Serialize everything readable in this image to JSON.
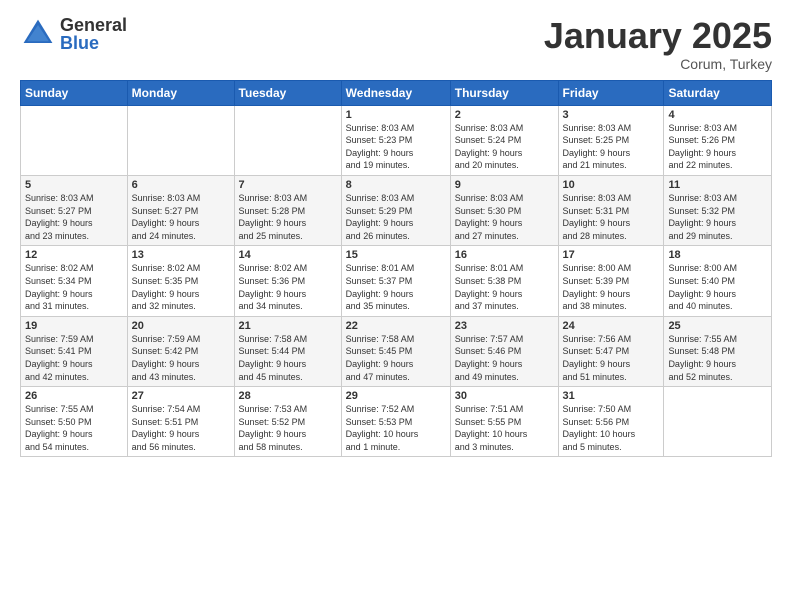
{
  "header": {
    "logo_general": "General",
    "logo_blue": "Blue",
    "title": "January 2025",
    "location": "Corum, Turkey"
  },
  "weekdays": [
    "Sunday",
    "Monday",
    "Tuesday",
    "Wednesday",
    "Thursday",
    "Friday",
    "Saturday"
  ],
  "weeks": [
    [
      {
        "day": "",
        "info": ""
      },
      {
        "day": "",
        "info": ""
      },
      {
        "day": "",
        "info": ""
      },
      {
        "day": "1",
        "info": "Sunrise: 8:03 AM\nSunset: 5:23 PM\nDaylight: 9 hours\nand 19 minutes."
      },
      {
        "day": "2",
        "info": "Sunrise: 8:03 AM\nSunset: 5:24 PM\nDaylight: 9 hours\nand 20 minutes."
      },
      {
        "day": "3",
        "info": "Sunrise: 8:03 AM\nSunset: 5:25 PM\nDaylight: 9 hours\nand 21 minutes."
      },
      {
        "day": "4",
        "info": "Sunrise: 8:03 AM\nSunset: 5:26 PM\nDaylight: 9 hours\nand 22 minutes."
      }
    ],
    [
      {
        "day": "5",
        "info": "Sunrise: 8:03 AM\nSunset: 5:27 PM\nDaylight: 9 hours\nand 23 minutes."
      },
      {
        "day": "6",
        "info": "Sunrise: 8:03 AM\nSunset: 5:27 PM\nDaylight: 9 hours\nand 24 minutes."
      },
      {
        "day": "7",
        "info": "Sunrise: 8:03 AM\nSunset: 5:28 PM\nDaylight: 9 hours\nand 25 minutes."
      },
      {
        "day": "8",
        "info": "Sunrise: 8:03 AM\nSunset: 5:29 PM\nDaylight: 9 hours\nand 26 minutes."
      },
      {
        "day": "9",
        "info": "Sunrise: 8:03 AM\nSunset: 5:30 PM\nDaylight: 9 hours\nand 27 minutes."
      },
      {
        "day": "10",
        "info": "Sunrise: 8:03 AM\nSunset: 5:31 PM\nDaylight: 9 hours\nand 28 minutes."
      },
      {
        "day": "11",
        "info": "Sunrise: 8:03 AM\nSunset: 5:32 PM\nDaylight: 9 hours\nand 29 minutes."
      }
    ],
    [
      {
        "day": "12",
        "info": "Sunrise: 8:02 AM\nSunset: 5:34 PM\nDaylight: 9 hours\nand 31 minutes."
      },
      {
        "day": "13",
        "info": "Sunrise: 8:02 AM\nSunset: 5:35 PM\nDaylight: 9 hours\nand 32 minutes."
      },
      {
        "day": "14",
        "info": "Sunrise: 8:02 AM\nSunset: 5:36 PM\nDaylight: 9 hours\nand 34 minutes."
      },
      {
        "day": "15",
        "info": "Sunrise: 8:01 AM\nSunset: 5:37 PM\nDaylight: 9 hours\nand 35 minutes."
      },
      {
        "day": "16",
        "info": "Sunrise: 8:01 AM\nSunset: 5:38 PM\nDaylight: 9 hours\nand 37 minutes."
      },
      {
        "day": "17",
        "info": "Sunrise: 8:00 AM\nSunset: 5:39 PM\nDaylight: 9 hours\nand 38 minutes."
      },
      {
        "day": "18",
        "info": "Sunrise: 8:00 AM\nSunset: 5:40 PM\nDaylight: 9 hours\nand 40 minutes."
      }
    ],
    [
      {
        "day": "19",
        "info": "Sunrise: 7:59 AM\nSunset: 5:41 PM\nDaylight: 9 hours\nand 42 minutes."
      },
      {
        "day": "20",
        "info": "Sunrise: 7:59 AM\nSunset: 5:42 PM\nDaylight: 9 hours\nand 43 minutes."
      },
      {
        "day": "21",
        "info": "Sunrise: 7:58 AM\nSunset: 5:44 PM\nDaylight: 9 hours\nand 45 minutes."
      },
      {
        "day": "22",
        "info": "Sunrise: 7:58 AM\nSunset: 5:45 PM\nDaylight: 9 hours\nand 47 minutes."
      },
      {
        "day": "23",
        "info": "Sunrise: 7:57 AM\nSunset: 5:46 PM\nDaylight: 9 hours\nand 49 minutes."
      },
      {
        "day": "24",
        "info": "Sunrise: 7:56 AM\nSunset: 5:47 PM\nDaylight: 9 hours\nand 51 minutes."
      },
      {
        "day": "25",
        "info": "Sunrise: 7:55 AM\nSunset: 5:48 PM\nDaylight: 9 hours\nand 52 minutes."
      }
    ],
    [
      {
        "day": "26",
        "info": "Sunrise: 7:55 AM\nSunset: 5:50 PM\nDaylight: 9 hours\nand 54 minutes."
      },
      {
        "day": "27",
        "info": "Sunrise: 7:54 AM\nSunset: 5:51 PM\nDaylight: 9 hours\nand 56 minutes."
      },
      {
        "day": "28",
        "info": "Sunrise: 7:53 AM\nSunset: 5:52 PM\nDaylight: 9 hours\nand 58 minutes."
      },
      {
        "day": "29",
        "info": "Sunrise: 7:52 AM\nSunset: 5:53 PM\nDaylight: 10 hours\nand 1 minute."
      },
      {
        "day": "30",
        "info": "Sunrise: 7:51 AM\nSunset: 5:55 PM\nDaylight: 10 hours\nand 3 minutes."
      },
      {
        "day": "31",
        "info": "Sunrise: 7:50 AM\nSunset: 5:56 PM\nDaylight: 10 hours\nand 5 minutes."
      },
      {
        "day": "",
        "info": ""
      }
    ]
  ]
}
